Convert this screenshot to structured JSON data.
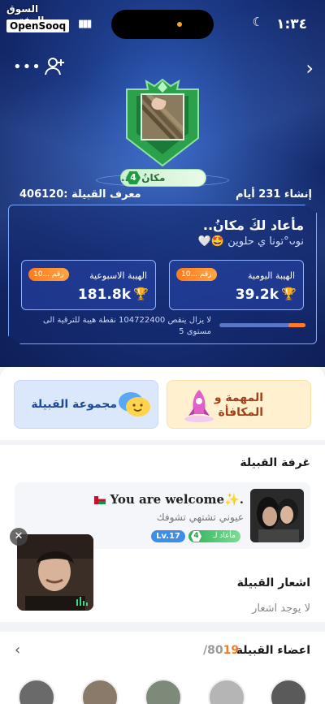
{
  "status_bar": {
    "time": "١:٣٤",
    "watermark_arabic": "السوق المفتوح",
    "watermark_brand": "OpenSooq"
  },
  "header": {
    "clan_name_badge": "مكانُ ما..",
    "clan_level": "4",
    "created": "إنشاء 231 أيام",
    "clan_id": "معرف القبيلة  :406120"
  },
  "info_card": {
    "welcome_title": "مأعاد لكَ مكانُ..",
    "subtitle": "نوᴗ°تونا ي حلوين 🤩🤍",
    "daily": {
      "label": "الهيبة اليومية",
      "value": "39.2k",
      "rank": "رقم ...10"
    },
    "weekly": {
      "label": "الهيبة الاسبوعية",
      "value": "181.8k",
      "rank": "رقم ...10"
    },
    "upgrade_text": "لا يزال ينقص  104722400  نقطة هيبة للترقية الى مستوى 5",
    "progress_fraction": 0.2
  },
  "tiles": {
    "mission": "المهمة و المكافأة",
    "group": "مجموعة القبيلة"
  },
  "clan_room": {
    "title": "غرفة القبيلة",
    "name": "You are welcome✨.",
    "description": "عيوني تشتهي تشوفك",
    "level_tag": "Lv.17",
    "clan_tag": "مأعاد لـ",
    "clan_tag_level": "4"
  },
  "notifications": {
    "title": "اشعار القبيلة",
    "empty": "لا يوجد اشعار"
  },
  "members": {
    "title": "اعضاء القبيلة",
    "count": "19",
    "total": "/80"
  },
  "colors": {
    "accent_orange": "#f07b2a",
    "clan_green": "#1f9b3f",
    "hero_blue": "#1c3a86"
  },
  "icons": [
    "more-icon",
    "add-user-icon",
    "forward-chevron-icon",
    "trophy-icon",
    "rocket-icon",
    "chat-bubbles-icon",
    "close-icon",
    "back-chevron-icon"
  ]
}
